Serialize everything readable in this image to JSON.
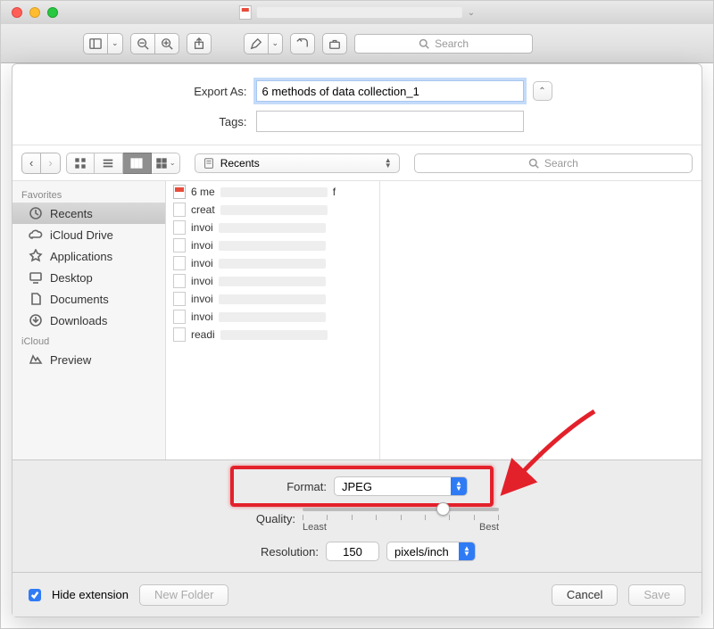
{
  "window": {
    "title_placeholder": ""
  },
  "toolbar": {
    "search_placeholder": "Search"
  },
  "export": {
    "export_as_label": "Export As:",
    "export_as_value": "6 methods of data collection_1",
    "tags_label": "Tags:",
    "tags_value": ""
  },
  "browser": {
    "location": "Recents",
    "search_placeholder": "Search"
  },
  "sidebar": {
    "section_favorites": "Favorites",
    "items_fav": [
      {
        "label": "Recents",
        "icon": "clock"
      },
      {
        "label": "iCloud Drive",
        "icon": "cloud"
      },
      {
        "label": "Applications",
        "icon": "apps"
      },
      {
        "label": "Desktop",
        "icon": "desktop"
      },
      {
        "label": "Documents",
        "icon": "doc"
      },
      {
        "label": "Downloads",
        "icon": "download"
      }
    ],
    "section_icloud": "iCloud",
    "items_icloud": [
      {
        "label": "Preview",
        "icon": "preview"
      }
    ]
  },
  "files": [
    {
      "name": "6 me",
      "suffix": "f",
      "type": "pdf"
    },
    {
      "name": "creat",
      "type": "generic"
    },
    {
      "name": "invoi",
      "type": "generic"
    },
    {
      "name": "invoi",
      "type": "generic"
    },
    {
      "name": "invoi",
      "type": "generic"
    },
    {
      "name": "invoi",
      "type": "generic"
    },
    {
      "name": "invoi",
      "type": "generic"
    },
    {
      "name": "invoi",
      "type": "generic"
    },
    {
      "name": "readi",
      "type": "generic"
    }
  ],
  "format": {
    "format_label": "Format:",
    "format_value": "JPEG",
    "quality_label": "Quality:",
    "quality_least": "Least",
    "quality_best": "Best",
    "resolution_label": "Resolution:",
    "resolution_value": "150",
    "resolution_unit": "pixels/inch"
  },
  "bottom": {
    "hide_extension": "Hide extension",
    "new_folder": "New Folder",
    "cancel": "Cancel",
    "save": "Save"
  }
}
